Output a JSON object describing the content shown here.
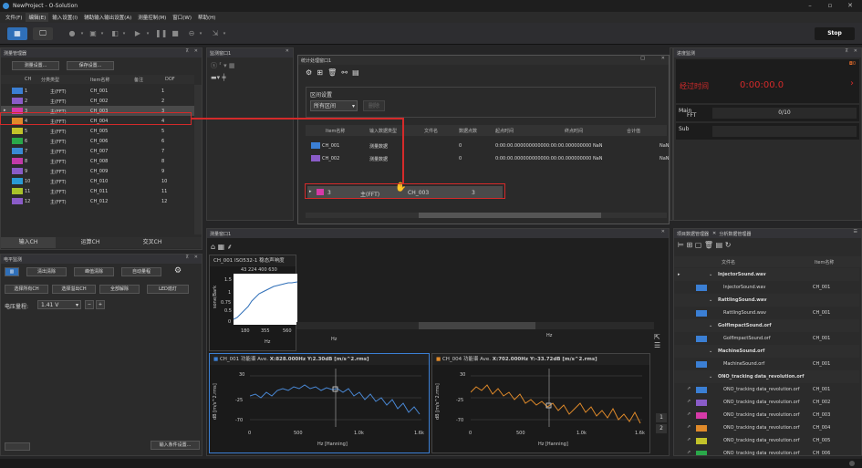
{
  "window": {
    "title": "NewProject - O-Solution",
    "stop": "Stop"
  },
  "menu": [
    "文件(F)",
    "编辑(E)",
    "输入设置(I)",
    "辅助输入输出设置(A)",
    "测量控制(M)",
    "窗口(W)",
    "帮助(H)"
  ],
  "measure_mgr": {
    "title": "测量管理器",
    "btn1": "测量设置...",
    "btn2": "保存设置...",
    "headers": [
      "CH",
      "分类类型",
      "Item名称",
      "备注",
      "DOF"
    ],
    "rows": [
      {
        "type": "主(FFT)",
        "name": "CH_001",
        "dof": "1",
        "color": "#3b7fd4"
      },
      {
        "type": "主(FFT)",
        "name": "CH_002",
        "dof": "2",
        "color": "#8a5cc8"
      },
      {
        "type": "主(FFT)",
        "name": "CH_003",
        "dof": "3",
        "color": "#d63aa8"
      },
      {
        "type": "主(FFT)",
        "name": "CH_004",
        "dof": "4",
        "color": "#e08a2a"
      },
      {
        "type": "主(FFT)",
        "name": "CH_005",
        "dof": "5",
        "color": "#c2c22a"
      },
      {
        "type": "主(FFT)",
        "name": "CH_006",
        "dof": "6",
        "color": "#2aa84a"
      },
      {
        "type": "主(FFT)",
        "name": "CH_007",
        "dof": "7",
        "color": "#3a8ad4"
      },
      {
        "type": "主(FFT)",
        "name": "CH_008",
        "dof": "8",
        "color": "#c23aa8"
      },
      {
        "type": "主(FFT)",
        "name": "CH_009",
        "dof": "9",
        "color": "#8a5cc8"
      },
      {
        "type": "主(FFT)",
        "name": "CH_010",
        "dof": "10",
        "color": "#2a9ad4"
      },
      {
        "type": "主(FFT)",
        "name": "CH_011",
        "dof": "11",
        "color": "#a8c22a"
      },
      {
        "type": "主(FFT)",
        "name": "CH_012",
        "dof": "12",
        "color": "#8a5cc8"
      }
    ],
    "row_labels": [
      "1",
      "2",
      "3",
      "4",
      "5",
      "6",
      "7",
      "8",
      "9",
      "10",
      "11",
      "12"
    ],
    "tabs": [
      "输入CH",
      "运算CH",
      "交叉CH"
    ]
  },
  "elec": {
    "title": "电平监测",
    "btn_a": "清出清除",
    "btn_b": "峰值清除",
    "btn_c": "自动量程",
    "btn_d": "选择所有CH",
    "btn_e": "选择溢出CH",
    "btn_f": "全部解除",
    "btn_g": "LED熄灯",
    "volt_label": "电压量程:",
    "volt_value": "1.41 V",
    "bottom_btn": "输入条件设置..."
  },
  "time_win": {
    "title": "监测窗口1"
  },
  "stat": {
    "title": "统计处理窗口1",
    "sect": "区间设置",
    "range": "所有区间",
    "range_btn": "删除",
    "headers": [
      "Item名称",
      "输入数据类型",
      "文件名",
      "数据点数",
      "起点时间",
      "终点时间",
      "合计值"
    ],
    "rows": [
      {
        "name": "CH_001",
        "dtype": "测量数据",
        "pts": "0",
        "times": "0:00:00.000000000000:00:00.000000000 NaN",
        "extra": "NaN",
        "color": "#3b7fd4"
      },
      {
        "name": "CH_002",
        "dtype": "测量数据",
        "pts": "0",
        "times": "0:00:00.000000000000:00:00.000000000 NaN",
        "extra": "NaN",
        "color": "#8a5cc8"
      }
    ],
    "drag_row": {
      "num": "3",
      "type": "主(FFT)",
      "name": "CH_003",
      "dof": "3"
    }
  },
  "monitor": {
    "title": "测量窗口1",
    "g1": {
      "title": "CH_001  ISO532-1 稳态声响度",
      "ticks": "43  224  400  630",
      "ylabel": "sone/Bark",
      "yt": [
        "1.5",
        "1",
        "0.75",
        "0.5",
        "0"
      ],
      "xt": [
        "180",
        "355",
        "560"
      ],
      "xlabel": "Hz"
    },
    "g2": {
      "title": "CH_001  功能谱  Ave.",
      "cursor": "X:828.000Hz Y:2.30dB [m/s^2.rms]",
      "ylabel": "dB [m/s^2.rms]",
      "yt": [
        "30",
        "-25",
        "-70"
      ],
      "xt": [
        "0",
        "500",
        "1.0k",
        "1.6k"
      ],
      "xlabel": "Hz [Hanning]"
    },
    "g3": {
      "title": "CH_004  功能谱  Ave.",
      "cursor": "X:702.000Hz Y:-33.72dB [m/s^2.rms]",
      "ylabel": "dB [m/s^2.rms]",
      "yt": [
        "30",
        "-25",
        "-70"
      ],
      "xt": [
        "0",
        "500",
        "1.0k",
        "1.6k"
      ],
      "xlabel": "Hz [Hanning]"
    },
    "mid_x": "Hz",
    "right_x": "Hz"
  },
  "progress": {
    "title": "进度监测",
    "elapsed_label": "经过时间",
    "elapsed": "0:00:00.0",
    "main": "Main",
    "fft": "FFT",
    "count": "0/10",
    "sub": "Sub",
    "badge": "0"
  },
  "files": {
    "tab1": "项目数据管理器",
    "tab2": "分析数据管理器",
    "h_name": "文件名",
    "h_item": "Item名称",
    "items": [
      {
        "label": "InjectorSound.wav",
        "group": true
      },
      {
        "label": "InjectorSound.wav",
        "item": "CH_001",
        "color": "#3b7fd4"
      },
      {
        "label": "RattlingSound.wav",
        "group": true
      },
      {
        "label": "RattlingSound.wav",
        "item": "CH_001",
        "color": "#3b7fd4"
      },
      {
        "label": "GolfImpactSound.orf",
        "group": true
      },
      {
        "label": "GolfImpactSound.orf",
        "item": "CH_001",
        "color": "#3b7fd4"
      },
      {
        "label": "MachineSound.orf",
        "group": true
      },
      {
        "label": "MachineSound.orf",
        "item": "CH_001",
        "color": "#3b7fd4"
      },
      {
        "label": "ONO_tracking data_revolution.orf",
        "group": true
      },
      {
        "label": "ONO_tracking data_revolution.orf",
        "item": "CH_001",
        "color": "#3b7fd4"
      },
      {
        "label": "ONO_tracking data_revolution.orf",
        "item": "CH_002",
        "color": "#8a5cc8"
      },
      {
        "label": "ONO_tracking data_revolution.orf",
        "item": "CH_003",
        "color": "#d63aa8"
      },
      {
        "label": "ONO_tracking data_revolution.orf",
        "item": "CH_004",
        "color": "#e08a2a"
      },
      {
        "label": "ONO_tracking data_revolution.orf",
        "item": "CH_005",
        "color": "#c2c22a"
      },
      {
        "label": "ONO_tracking data_revolution.orf",
        "item": "CH_006",
        "color": "#2aa84a"
      }
    ]
  }
}
